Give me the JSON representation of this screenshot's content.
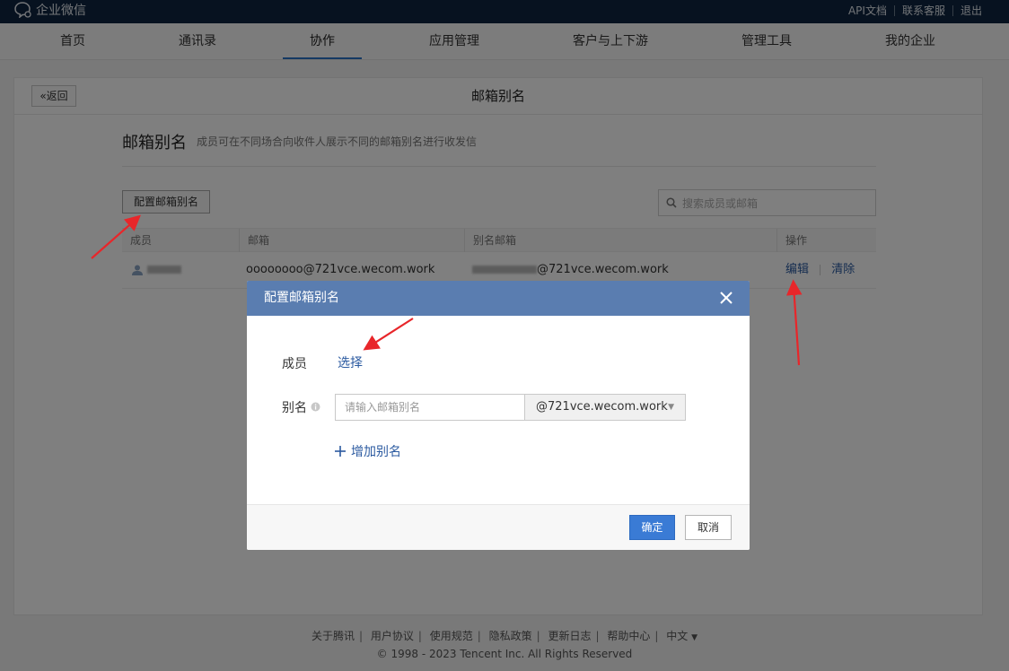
{
  "topbar": {
    "logo_text": "企业微信",
    "links": [
      "API文档",
      "联系客服",
      "退出"
    ]
  },
  "nav": {
    "items": [
      "首页",
      "通讯录",
      "协作",
      "应用管理",
      "客户与上下游",
      "管理工具",
      "我的企业"
    ],
    "active": "协作"
  },
  "page": {
    "back_label": "«返回",
    "title": "邮箱别名",
    "section_title": "邮箱别名",
    "section_desc": "成员可在不同场合向收件人展示不同的邮箱别名进行收发信",
    "config_button": "配置邮箱别名",
    "search_placeholder": "搜索成员或邮箱"
  },
  "table": {
    "headers": [
      "成员",
      "邮箱",
      "别名邮箱",
      "操作"
    ],
    "rows": [
      {
        "member": "",
        "email": "oooooooo@721vce.wecom.work",
        "alias_email": "@721vce.wecom.work",
        "actions": [
          "编辑",
          "清除"
        ]
      }
    ]
  },
  "modal": {
    "title": "配置邮箱别名",
    "member_label": "成员",
    "select_link": "选择",
    "alias_label": "别名",
    "alias_placeholder": "请输入邮箱别名",
    "domain_value": "@721vce.wecom.work",
    "add_alias": "增加别名",
    "ok_label": "确定",
    "cancel_label": "取消"
  },
  "footer": {
    "links": [
      "关于腾讯",
      "用户协议",
      "使用规范",
      "隐私政策",
      "更新日志",
      "帮助中心",
      "中文"
    ],
    "copyright": "© 1998 - 2023 Tencent Inc. All Rights Reserved"
  },
  "colors": {
    "topbar_bg": "#0f2440",
    "modal_header": "#5a7db0",
    "primary_button": "#3a7bd5",
    "link": "#2b5aa0",
    "annotation_arrow": "#e8262a"
  }
}
